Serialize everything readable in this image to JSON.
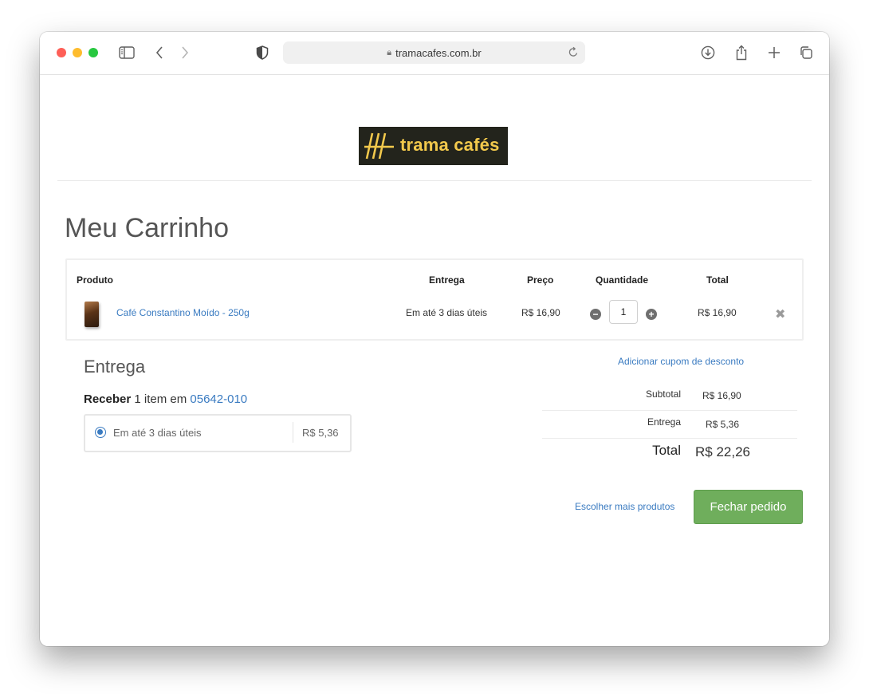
{
  "browser": {
    "url": "tramacafes.com.br"
  },
  "site": {
    "logo_text": "trama cafés"
  },
  "page": {
    "title": "Meu Carrinho"
  },
  "cart": {
    "headers": {
      "product": "Produto",
      "delivery": "Entrega",
      "price": "Preço",
      "quantity": "Quantidade",
      "total": "Total"
    },
    "items": [
      {
        "name": "Café Constantino Moído - 250g",
        "delivery": "Em até 3 dias úteis",
        "price": "R$ 16,90",
        "quantity": "1",
        "total": "R$ 16,90"
      }
    ]
  },
  "shipping": {
    "title": "Entrega",
    "receive_label": "Receber",
    "receive_text": " 1 item em ",
    "cep": "05642-010",
    "option_label": "Em até 3 dias úteis",
    "option_price": "R$ 5,36"
  },
  "summary": {
    "coupon_link": "Adicionar cupom de desconto",
    "subtotal_label": "Subtotal",
    "subtotal_value": "R$ 16,90",
    "shipping_label": "Entrega",
    "shipping_value": "R$ 5,36",
    "total_label": "Total",
    "total_value": "R$ 22,26"
  },
  "actions": {
    "more_products": "Escolher mais produtos",
    "checkout": "Fechar pedido"
  },
  "colors": {
    "link": "#3a7bc1",
    "checkout_button": "#6fae5c",
    "logo_bg": "#23241c",
    "logo_text": "#f2c94c"
  }
}
